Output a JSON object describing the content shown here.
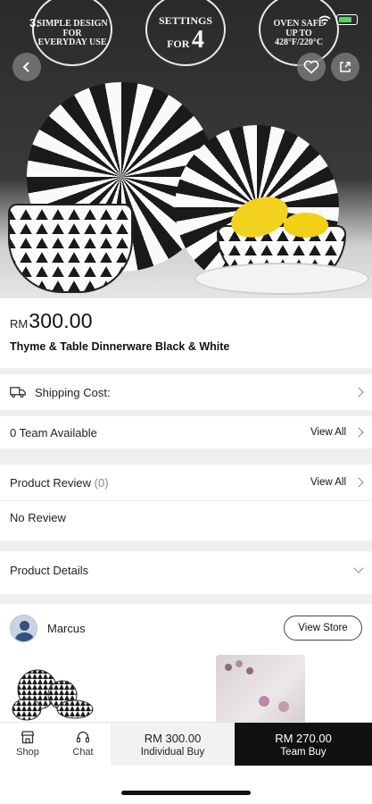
{
  "status_bar": {
    "time": "3:"
  },
  "hero": {
    "badges": [
      {
        "line1": "SIMPLE DESIGN FOR",
        "line2": "EVERYDAY USE"
      },
      {
        "line1": "SETTINGS",
        "line2": "FOR",
        "big": "4"
      },
      {
        "line1": "OVEN SAFE",
        "line2": "UP TO",
        "line3": "428°F/220°C"
      }
    ]
  },
  "product": {
    "currency": "RM",
    "price": "300.00",
    "title": "Thyme & Table Dinnerware Black & White"
  },
  "sections": {
    "shipping_label": "Shipping Cost:",
    "team_available": "0 Team Available",
    "view_all": "View All",
    "review_label": "Product Review",
    "review_count": "(0)",
    "no_review": "No Review",
    "details_label": "Product Details"
  },
  "store": {
    "name": "Marcus",
    "view_store": "View Store"
  },
  "bottom_bar": {
    "shop": "Shop",
    "chat": "Chat",
    "individual_price": "RM 300.00",
    "individual_label": "Individual Buy",
    "team_price": "RM 270.00",
    "team_label": "Team Buy"
  },
  "colors": {
    "accent_dark": "#111111",
    "battery": "#4cd964"
  }
}
